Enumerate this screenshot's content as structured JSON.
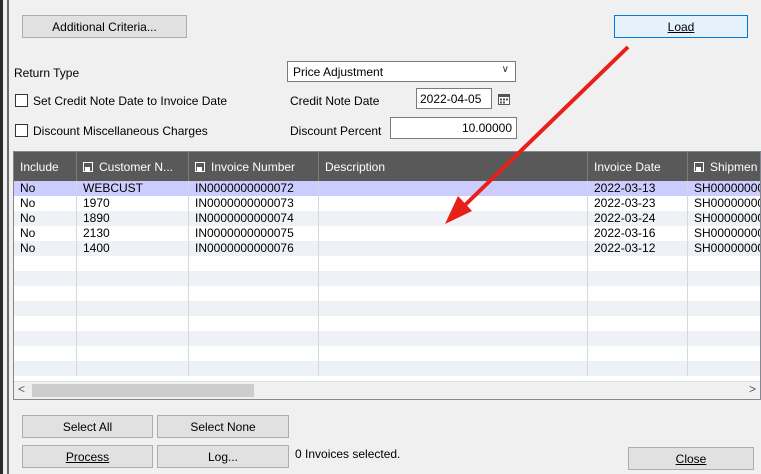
{
  "toolbar": {
    "additional_criteria": "Additional Criteria...",
    "load": "Load"
  },
  "form": {
    "return_type_label": "Return Type",
    "return_type_value": "Price Adjustment",
    "set_credit_note_label": "Set Credit Note Date to Invoice Date",
    "credit_note_date_label": "Credit Note Date",
    "credit_note_date_value": "2022-04-05",
    "discount_misc_label": "Discount Miscellaneous Charges",
    "discount_percent_label": "Discount Percent",
    "discount_percent_value": "10.00000"
  },
  "grid": {
    "columns": [
      "Include",
      "Customer N...",
      "Invoice Number",
      "Description",
      "Invoice Date",
      "Shipmen"
    ],
    "rows": [
      [
        "No",
        "WEBCUST",
        "IN0000000000072",
        "",
        "2022-03-13",
        "SH00000000"
      ],
      [
        "No",
        "1970",
        "IN0000000000073",
        "",
        "2022-03-23",
        "SH00000000"
      ],
      [
        "No",
        "1890",
        "IN0000000000074",
        "",
        "2022-03-24",
        "SH00000000"
      ],
      [
        "No",
        "2130",
        "IN0000000000075",
        "",
        "2022-03-16",
        "SH00000000"
      ],
      [
        "No",
        "1400",
        "IN0000000000076",
        "",
        "2022-03-12",
        "SH00000000"
      ]
    ]
  },
  "footer": {
    "select_all": "Select All",
    "select_none": "Select None",
    "process": "Process",
    "log": "Log...",
    "status": "0 Invoices selected.",
    "close": "Close"
  },
  "colors": {
    "selected_row": "#ccccff",
    "header_bg": "#595959",
    "annotation_arrow": "#e8201a"
  }
}
